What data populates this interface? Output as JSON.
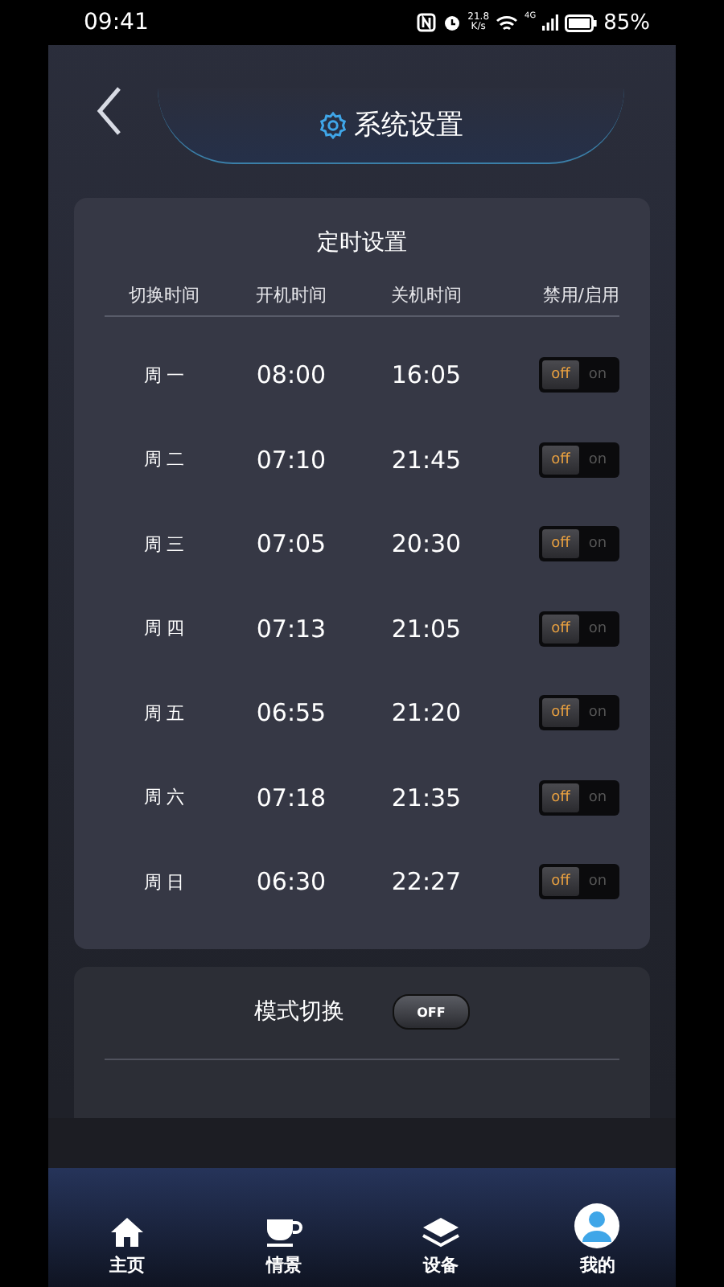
{
  "status_bar": {
    "time": "09:41",
    "speed": "21.8",
    "speed_unit": "K/s",
    "network": "4G",
    "battery": "85%"
  },
  "header": {
    "title": "系统设置"
  },
  "schedule": {
    "title": "定时设置",
    "columns": [
      "切换时间",
      "开机时间",
      "关机时间",
      "禁用/启用"
    ],
    "rows": [
      {
        "day": "周 一",
        "on_time": "08:00",
        "off_time": "16:05",
        "off_label": "off",
        "on_label": "on",
        "enabled": false
      },
      {
        "day": "周 二",
        "on_time": "07:10",
        "off_time": "21:45",
        "off_label": "off",
        "on_label": "on",
        "enabled": false
      },
      {
        "day": "周 三",
        "on_time": "07:05",
        "off_time": "20:30",
        "off_label": "off",
        "on_label": "on",
        "enabled": false
      },
      {
        "day": "周 四",
        "on_time": "07:13",
        "off_time": "21:05",
        "off_label": "off",
        "on_label": "on",
        "enabled": false
      },
      {
        "day": "周 五",
        "on_time": "06:55",
        "off_time": "21:20",
        "off_label": "off",
        "on_label": "on",
        "enabled": false
      },
      {
        "day": "周 六",
        "on_time": "07:18",
        "off_time": "21:35",
        "off_label": "off",
        "on_label": "on",
        "enabled": false
      },
      {
        "day": "周 日",
        "on_time": "06:30",
        "off_time": "22:27",
        "off_label": "off",
        "on_label": "on",
        "enabled": false
      }
    ]
  },
  "mode": {
    "label": "模式切换",
    "switch_label": "OFF",
    "on": false
  },
  "nav": [
    {
      "kind": "home",
      "label": "主页"
    },
    {
      "kind": "cup",
      "label": "情景"
    },
    {
      "kind": "layers",
      "label": "设备"
    },
    {
      "kind": "user",
      "label": "我的"
    }
  ]
}
